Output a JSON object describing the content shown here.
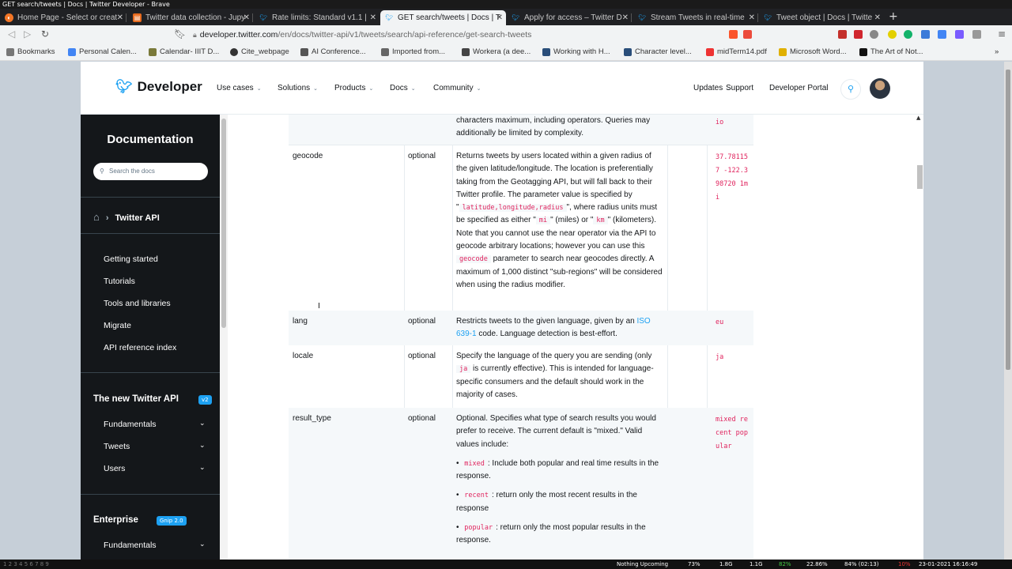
{
  "window_title": "GET search/tweets | Docs | Twitter Developer - Brave",
  "tabs": [
    {
      "label": "Home Page - Select or creat",
      "icon": "jupyter-icon"
    },
    {
      "label": "Twitter data collection - Jupy",
      "icon": "notebook-icon"
    },
    {
      "label": "Rate limits: Standard v1.1 |",
      "icon": "twitter-icon"
    },
    {
      "label": "GET search/tweets | Docs | T",
      "icon": "twitter-icon",
      "active": true
    },
    {
      "label": "Apply for access – Twitter D",
      "icon": "twitter-icon"
    },
    {
      "label": "Stream Tweets in real-time",
      "icon": "twitter-icon"
    },
    {
      "label": "Tweet object | Docs | Twitte",
      "icon": "twitter-icon"
    }
  ],
  "address": {
    "domain": "developer.twitter.com",
    "path": "/en/docs/twitter-api/v1/tweets/search/api-reference/get-search-tweets"
  },
  "bookmarks": [
    "Bookmarks",
    "Personal Calen...",
    "Calendar- IIIT D...",
    "Cite_webpage",
    "AI Conference...",
    "Imported from...",
    "Workera (a dee...",
    "Working with H...",
    "Character level...",
    "midTerm14.pdf",
    "Microsoft Word...",
    "The Art of Not..."
  ],
  "header": {
    "logo_text": "Developer",
    "nav": [
      "Use cases",
      "Solutions",
      "Products",
      "Docs",
      "Community"
    ],
    "right": [
      "Updates",
      "Support",
      "Developer Portal"
    ]
  },
  "sidebar": {
    "title": "Documentation",
    "search_placeholder": "Search the docs",
    "crumb": "Twitter API",
    "items": [
      "Getting started",
      "Tutorials",
      "Tools and libraries",
      "Migrate",
      "API reference index"
    ],
    "section1": {
      "title": "The new Twitter API",
      "badge": "v2",
      "items": [
        "Fundamentals",
        "Tweets",
        "Users"
      ]
    },
    "section2": {
      "title": "Enterprise",
      "badge": "Gnip 2.0",
      "items": [
        "Fundamentals"
      ]
    }
  },
  "table": {
    "q_tail": {
      "desc": "characters maximum, including operators. Queries may additionally be limited by complexity.",
      "example": "io"
    },
    "geocode": {
      "name": "geocode",
      "req": "optional",
      "d1": "Returns tweets by users located within a given radius of the given latitude/longitude. The location is preferentially taking from the Geotagging API, but will fall back to their Twitter profile. The parameter value is specified by \"",
      "c1": "latitude,longitude,radius",
      "d2": "\", where radius units must be specified as either \"",
      "c2": "mi",
      "d3": "\" (miles) or \"",
      "c3": "km",
      "d4": "\" (kilometers). Note that you cannot use the near operator via the API to geocode arbitrary locations; however you can use this",
      "c4": "geocode",
      "d5": "parameter to search near geocodes directly. A maximum of 1,000 distinct \"sub-regions\" will be considered when using the radius modifier.",
      "example": "37.781157 -122.398720 1mi"
    },
    "lang": {
      "name": "lang",
      "req": "optional",
      "d1": "Restricts tweets to the given language, given by an",
      "link": "ISO 639-1",
      "d2": "code. Language detection is best-effort.",
      "example": "eu"
    },
    "locale": {
      "name": "locale",
      "req": "optional",
      "d1": "Specify the language of the query you are sending (only",
      "c1": "ja",
      "d2": "is currently effective). This is intended for language-specific consumers and the default should work in the majority of cases.",
      "example": "ja"
    },
    "result_type": {
      "name": "result_type",
      "req": "optional",
      "d1": "Optional. Specifies what type of search results you would prefer to receive. The current default is \"mixed.\" Valid values include:",
      "opts": [
        {
          "code": "mixed",
          "text": ": Include both popular and real time results in the response."
        },
        {
          "code": "recent",
          "text": ": return only the most recent results in the response"
        },
        {
          "code": "popular",
          "text": ": return only the most popular results in the response."
        }
      ],
      "example": "mixed recent popular"
    }
  },
  "taskbar": {
    "workspaces": "1 2 3 4 5 6 7 8 9",
    "items": [
      "Nothing Upcoming",
      "73%",
      "1.8G",
      "1.1G",
      "82%",
      "22.86%",
      "84% (02:13)",
      "10%",
      "23-01-2021 16:16:49"
    ]
  }
}
